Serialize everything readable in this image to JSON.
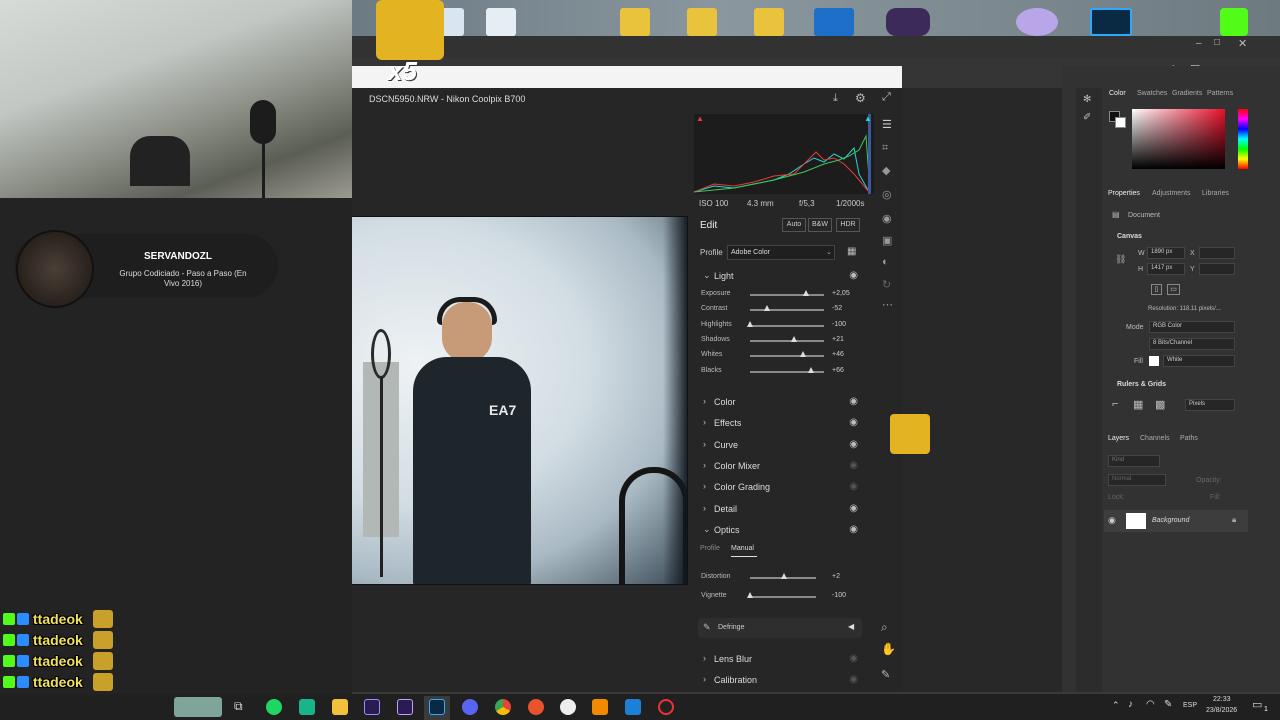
{
  "acr": {
    "file_label": "DSCN5950.NRW  -  Nikon Coolpix B700",
    "info": {
      "iso": "ISO 100",
      "focal": "4.3 mm",
      "aperture": "f/5,3",
      "shutter": "1/2000s"
    },
    "edit_label": "Edit",
    "buttons": {
      "auto": "Auto",
      "bw": "B&W",
      "hdr": "HDR"
    },
    "profile_label": "Profile",
    "profile_value": "Adobe Color",
    "light": {
      "title": "Light",
      "sliders": [
        {
          "name": "Exposure",
          "value": "+2,05",
          "level": 0.75
        },
        {
          "name": "Contrast",
          "value": "-52",
          "level": 0.23
        },
        {
          "name": "Highlights",
          "value": "-100",
          "level": 0.0
        },
        {
          "name": "Shadows",
          "value": "+21",
          "level": 0.6
        },
        {
          "name": "Whites",
          "value": "+46",
          "level": 0.72
        },
        {
          "name": "Blacks",
          "value": "+66",
          "level": 0.83
        }
      ]
    },
    "sections": [
      "Color",
      "Effects",
      "Curve",
      "Color Mixer",
      "Color Grading",
      "Detail"
    ],
    "optics": {
      "title": "Optics",
      "tabs": {
        "profile": "Profile",
        "manual": "Manual"
      },
      "sliders": [
        {
          "name": "Distortion",
          "value": "+2",
          "level": 0.51
        },
        {
          "name": "Vignette",
          "value": "-100",
          "level": 0.0
        }
      ],
      "defringe": "Defringe"
    },
    "bottom_sections": [
      "Lens Blur",
      "Calibration"
    ]
  },
  "stream": {
    "profile_name": "SERVANDOZL",
    "profile_sub": "Grupo Codiciado - Paso a Paso (En Vivo 2016)",
    "chat_user": "ttadeok",
    "chat_rows": 5,
    "badge_x5": "x5"
  },
  "right_panel": {
    "color_tabs": [
      "Color",
      "Swatches",
      "Gradients",
      "Patterns"
    ],
    "props_tabs": [
      "Properties",
      "Adjustments",
      "Libraries"
    ],
    "document_label": "Document",
    "canvas_label": "Canvas",
    "w_label": "W",
    "w_value": "1890 px",
    "h_label": "H",
    "h_value": "1417 px",
    "x_label": "X",
    "y_label": "Y",
    "resolution": "Resolution: 118,11 pixels/...",
    "mode_label": "Mode",
    "mode_value": "RGB Color",
    "depth_value": "8 Bits/Channel",
    "fill_label": "Fill",
    "fill_value": "White",
    "rulers_label": "Rulers & Grids",
    "units_value": "Pixels",
    "layers_tabs": [
      "Layers",
      "Channels",
      "Paths"
    ],
    "kind_label": "Kind",
    "blend_label": "Normal",
    "opacity_label": "Opacity:",
    "lock_label": "Lock:",
    "fill2_label": "Fill:",
    "layer_name": "Background"
  },
  "taskbar": {
    "lang": "ESP",
    "time": "22:33",
    "date": "23/8/2026",
    "notif": "1"
  },
  "colors": {
    "accent_red": "#e8102a",
    "chat_yellow": "#f2e15a",
    "ps_blue": "#31a8ff"
  }
}
